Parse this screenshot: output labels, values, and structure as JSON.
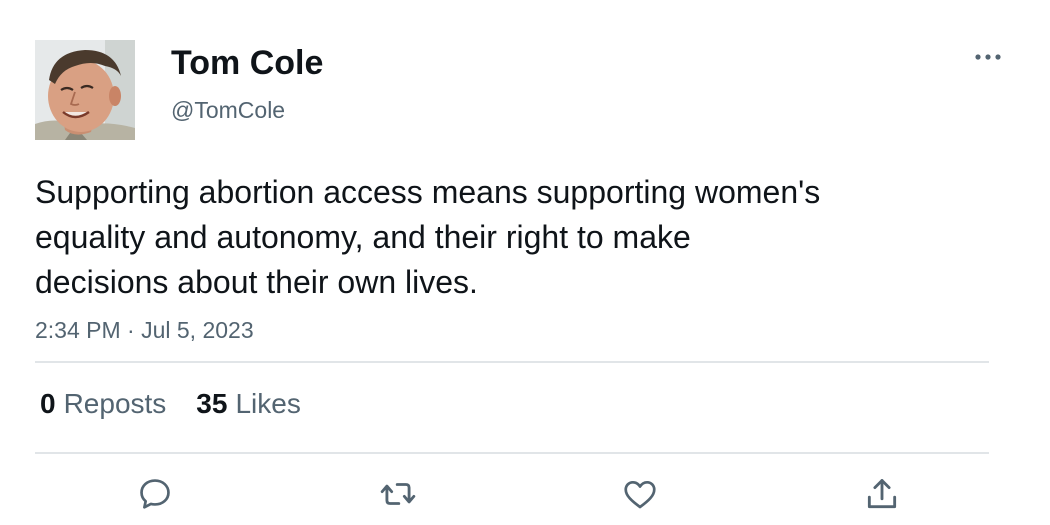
{
  "author": {
    "display_name": "Tom Cole",
    "handle": "@TomCole",
    "avatar": "profile-photo"
  },
  "tweet": {
    "text": "Supporting abortion access means supporting women's\nequality and autonomy, and their right to make\ndecisions about their own lives.",
    "timestamp": "2:34 PM · Jul 5, 2023"
  },
  "stats": {
    "reposts_count": "0",
    "reposts_label": "Reposts",
    "likes_count": "35",
    "likes_label": "Likes"
  },
  "actions": [
    {
      "name": "reply",
      "icon": "speech-bubble-icon"
    },
    {
      "name": "repost",
      "icon": "repost-arrows-icon"
    },
    {
      "name": "like",
      "icon": "heart-icon"
    },
    {
      "name": "share",
      "icon": "share-upload-icon"
    }
  ],
  "colors": {
    "text_primary": "#0f1419",
    "text_secondary": "#536471",
    "divider": "#e1e5e8",
    "icon": "#536471"
  }
}
